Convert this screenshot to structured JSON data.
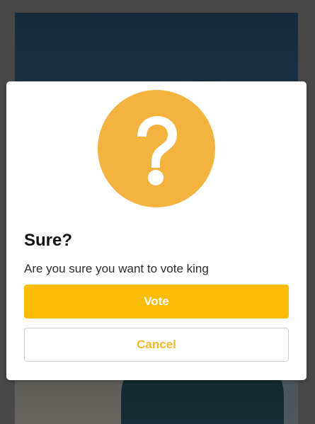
{
  "dialog": {
    "icon": "question-mark-icon",
    "icon_color": "#f4b33f",
    "title": "Sure?",
    "message": "Are you sure you want to vote king",
    "confirm_label": "Vote",
    "confirm_color": "#fbbc05",
    "cancel_label": "Cancel",
    "cancel_text_color": "#f3b82a"
  }
}
